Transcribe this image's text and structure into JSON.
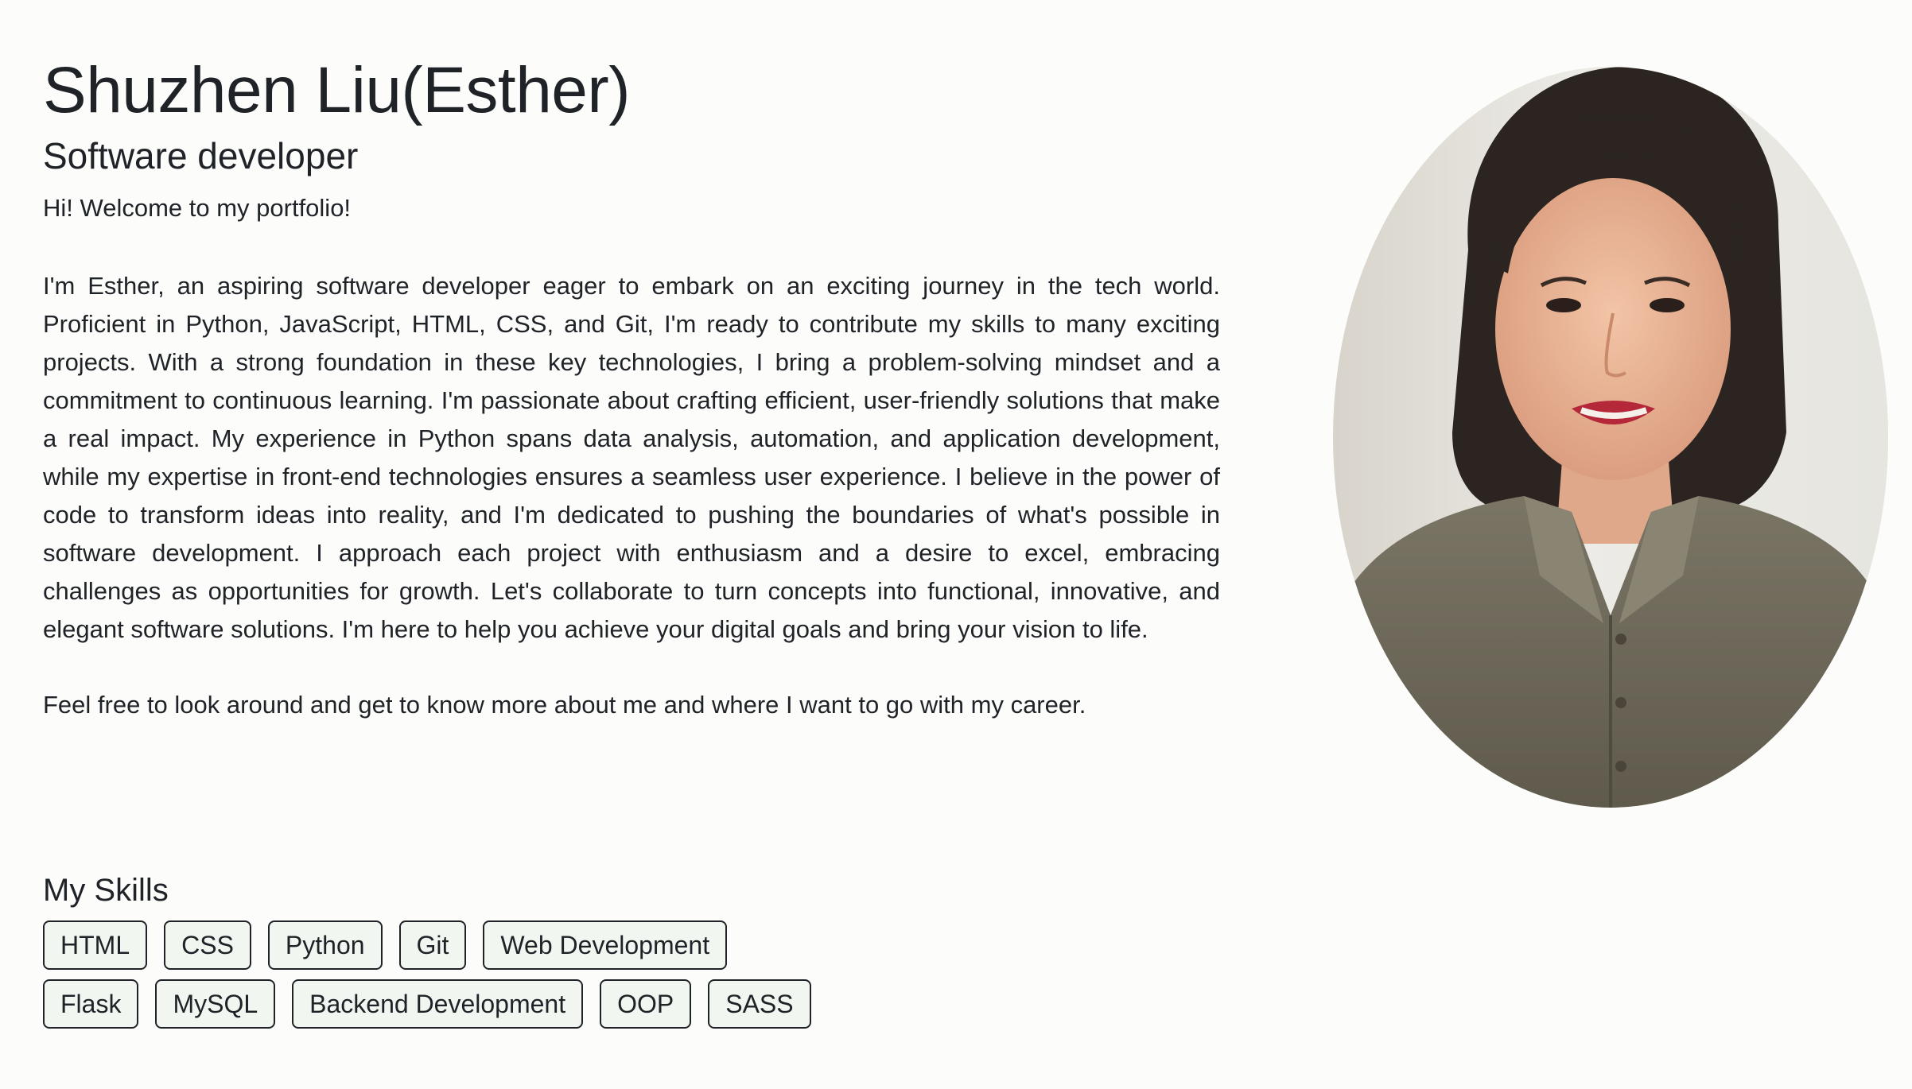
{
  "header": {
    "name": "Shuzhen Liu(Esther)",
    "role": "Software developer"
  },
  "intro": {
    "greeting": "Hi! Welcome to my portfolio!",
    "bio": "I'm Esther, an aspiring software developer eager to embark on an exciting journey in the tech world. Proficient in Python, JavaScript, HTML, CSS, and Git, I'm ready to contribute my skills to many exciting projects. With a strong foundation in these key technologies, I bring a problem-solving mindset and a commitment to continuous learning. I'm passionate about crafting efficient, user-friendly solutions that make a real impact. My experience in Python spans data analysis, automation, and application development, while my expertise in front-end technologies ensures a seamless user experience. I believe in the power of code to transform ideas into reality, and I'm dedicated to pushing the boundaries of what's possible in software development. I approach each project with enthusiasm and a desire to excel, embracing challenges as opportunities for growth. Let's collaborate to turn concepts into functional, innovative, and elegant software solutions. I'm here to help you achieve your digital goals and bring your vision to life.",
    "closing": "Feel free to look around and get to know more about me and where I want to go with my career."
  },
  "skills": {
    "title": "My Skills",
    "items": [
      "HTML",
      "CSS",
      "Python",
      "Git",
      "Web Development",
      "Flask",
      "MySQL",
      "Backend Development",
      "OOP",
      "SASS"
    ]
  },
  "colors": {
    "background": "#fcfcfa",
    "text": "#1f2328",
    "tag_background": "#f1f7f0",
    "tag_border": "#1f2328"
  }
}
